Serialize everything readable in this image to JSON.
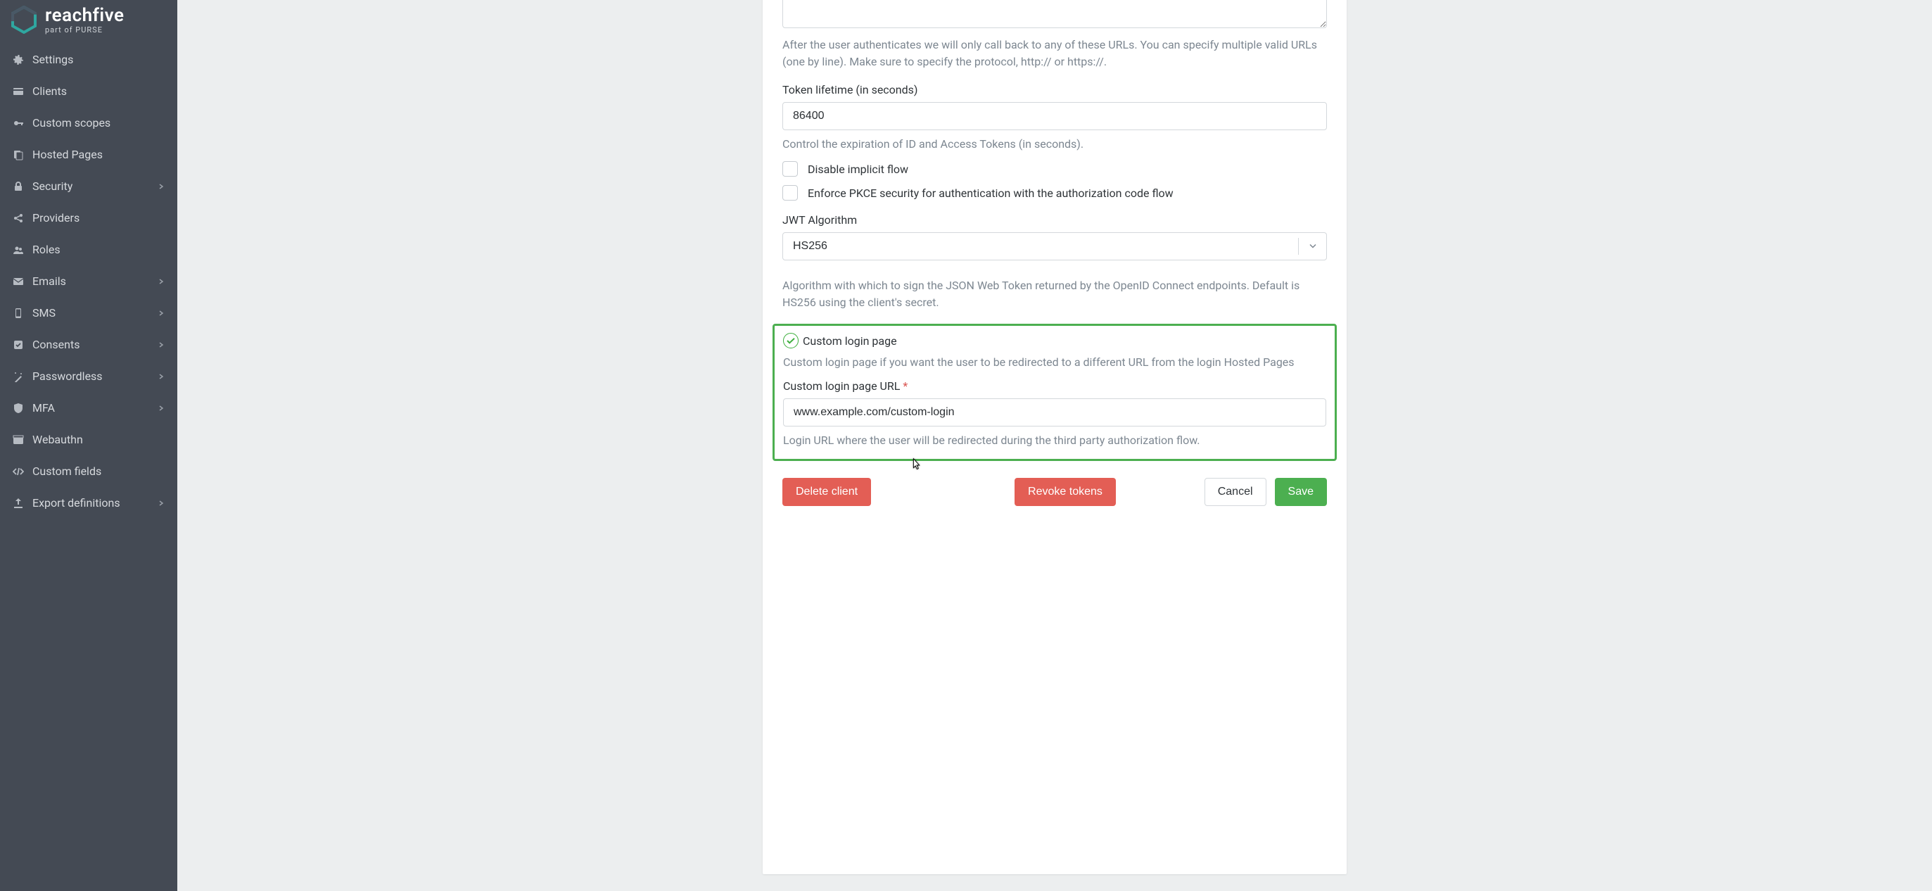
{
  "brand": {
    "name": "reachfive",
    "tagline": "part of PURSE"
  },
  "sidebar": {
    "items": [
      {
        "label": "Settings",
        "icon": "gear-icon",
        "expandable": false
      },
      {
        "label": "Clients",
        "icon": "card-icon",
        "expandable": false
      },
      {
        "label": "Custom scopes",
        "icon": "key-icon",
        "expandable": false
      },
      {
        "label": "Hosted Pages",
        "icon": "pages-icon",
        "expandable": false
      },
      {
        "label": "Security",
        "icon": "lock-icon",
        "expandable": true
      },
      {
        "label": "Providers",
        "icon": "share-icon",
        "expandable": false
      },
      {
        "label": "Roles",
        "icon": "users-icon",
        "expandable": false
      },
      {
        "label": "Emails",
        "icon": "envelope-icon",
        "expandable": true
      },
      {
        "label": "SMS",
        "icon": "phone-icon",
        "expandable": true
      },
      {
        "label": "Consents",
        "icon": "check-square-icon",
        "expandable": true
      },
      {
        "label": "Passwordless",
        "icon": "wand-icon",
        "expandable": true
      },
      {
        "label": "MFA",
        "icon": "shield-icon",
        "expandable": true
      },
      {
        "label": "Webauthn",
        "icon": "browser-icon",
        "expandable": false
      },
      {
        "label": "Custom fields",
        "icon": "code-icon",
        "expandable": false
      },
      {
        "label": "Export definitions",
        "icon": "export-icon",
        "expandable": true
      }
    ]
  },
  "form": {
    "callback_urls_hint": "After the user authenticates we will only call back to any of these URLs. You can specify multiple valid URLs (one by line). Make sure to specify the protocol, http:// or https://.",
    "token_lifetime_label": "Token lifetime (in seconds)",
    "token_lifetime_value": "86400",
    "token_lifetime_hint": "Control the expiration of ID and Access Tokens (in seconds).",
    "disable_implicit_label": "Disable implicit flow",
    "enforce_pkce_label": "Enforce PKCE security for authentication with the authorization code flow",
    "jwt_algorithm_label": "JWT Algorithm",
    "jwt_algorithm_value": "HS256",
    "jwt_algorithm_hint": "Algorithm with which to sign the JSON Web Token returned by the OpenID Connect endpoints. Default is HS256 using the client's secret.",
    "custom_login_page_label": "Custom login page",
    "custom_login_page_hint": "Custom login page if you want the user to be redirected to a different URL from the login Hosted Pages",
    "custom_login_url_label": "Custom login page URL",
    "custom_login_url_value": "www.example.com/custom-login",
    "custom_login_url_hint": "Login URL where the user will be redirected during the third party authorization flow."
  },
  "actions": {
    "delete": "Delete client",
    "revoke": "Revoke tokens",
    "cancel": "Cancel",
    "save": "Save"
  }
}
